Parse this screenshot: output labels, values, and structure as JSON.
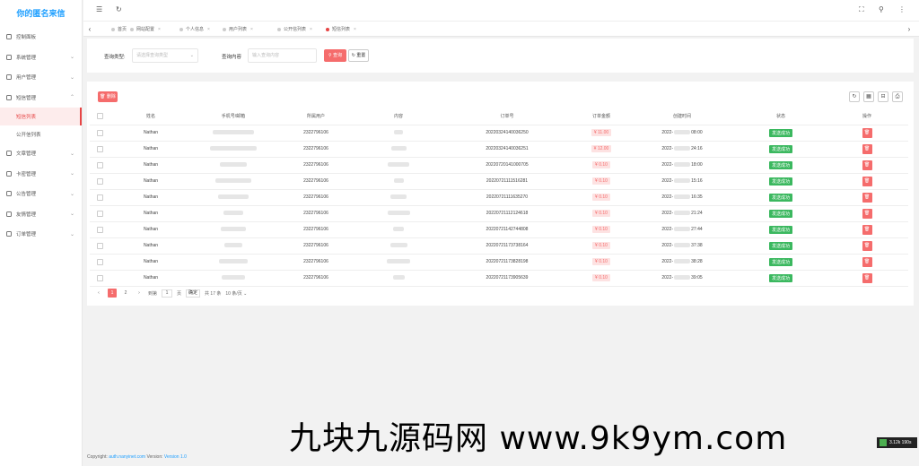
{
  "sidebar": {
    "logo": "你的匿名来信",
    "items": [
      {
        "label": "控制面板",
        "chev": ""
      },
      {
        "label": "系统管理",
        "chev": "⌄"
      },
      {
        "label": "用户管理",
        "chev": "⌄"
      },
      {
        "label": "短信管理",
        "chev": "⌃"
      }
    ],
    "sub_items": [
      {
        "label": "短信列表"
      },
      {
        "label": "公开信列表"
      }
    ],
    "items_after": [
      {
        "label": "文章管理",
        "chev": "⌄"
      },
      {
        "label": "卡密管理",
        "chev": "⌄"
      },
      {
        "label": "公告管理",
        "chev": "⌄"
      },
      {
        "label": "友情管理",
        "chev": "⌄"
      },
      {
        "label": "订单管理",
        "chev": "⌄"
      }
    ]
  },
  "header": {
    "menu_icon": "☰",
    "refresh_icon": "↻",
    "fullscreen_icon": "⛶",
    "user_icon": "⚲",
    "more_icon": "⋮"
  },
  "tabs": [
    {
      "label": "首页"
    },
    {
      "label": "网站配置"
    },
    {
      "label": "个人信息"
    },
    {
      "label": "用户列表"
    },
    {
      "label": "公开信列表"
    },
    {
      "label": "短信列表"
    }
  ],
  "search": {
    "type_label": "查询类型:",
    "type_placeholder": "请选择查询类型",
    "content_label": "查询内容",
    "content_placeholder": "输入查询内容",
    "search_btn": "查询",
    "reset_btn": "重置"
  },
  "table": {
    "delete_btn": "删除",
    "columns": [
      "",
      "姓名",
      "手机号/邮箱",
      "所属用户",
      "内容",
      "订单号",
      "订单金额",
      "创建时间",
      "状态",
      "操作"
    ],
    "rows": [
      {
        "name": "Nathan",
        "user": "2322796106",
        "order_no": "20220324140036250",
        "amount": "¥ 11.00",
        "time_pre": "2022-",
        "time_post": "08:00",
        "status": "发送成功"
      },
      {
        "name": "Nathan",
        "user": "2322796106",
        "order_no": "20220324140036251",
        "amount": "¥ 12.00",
        "time_pre": "2022-",
        "time_post": "24:16",
        "status": "发送成功"
      },
      {
        "name": "Nathan",
        "user": "2322796106",
        "order_no": "20220720141000705",
        "amount": "¥ 0.10",
        "time_pre": "2022-",
        "time_post": "18:00",
        "status": "发送成功"
      },
      {
        "name": "Nathan",
        "user": "2322796106",
        "order_no": "20220721111516281",
        "amount": "¥ 0.10",
        "time_pre": "2022-",
        "time_post": "15:16",
        "status": "发送成功"
      },
      {
        "name": "Nathan",
        "user": "2322796106",
        "order_no": "20220721111635270",
        "amount": "¥ 0.10",
        "time_pre": "2022-",
        "time_post": "16:35",
        "status": "发送成功"
      },
      {
        "name": "Nathan",
        "user": "2322796106",
        "order_no": "20220721112124618",
        "amount": "¥ 0.10",
        "time_pre": "2022-",
        "time_post": "21:24",
        "status": "发送成功"
      },
      {
        "name": "Nathan",
        "user": "2322796106",
        "order_no": "20220721142744808",
        "amount": "¥ 0.10",
        "time_pre": "2022-",
        "time_post": "27:44",
        "status": "发送成功"
      },
      {
        "name": "Nathan",
        "user": "2322796106",
        "order_no": "20220721173738164",
        "amount": "¥ 0.10",
        "time_pre": "2022-",
        "time_post": "37:38",
        "status": "发送成功"
      },
      {
        "name": "Nathan",
        "user": "2322796106",
        "order_no": "20220721173828198",
        "amount": "¥ 0.10",
        "time_pre": "2022-",
        "time_post": "38:28",
        "status": "发送成功"
      },
      {
        "name": "Nathan",
        "user": "2322796106",
        "order_no": "20220721173905639",
        "amount": "¥ 0.10",
        "time_pre": "2022-",
        "time_post": "39:05",
        "status": "发送成功"
      }
    ],
    "op_icon": "🗑"
  },
  "pager": {
    "prev": "‹",
    "page1": "1",
    "page2": "2",
    "next": "›",
    "goto_label": "到第",
    "goto_value": "1",
    "page_unit": "页",
    "confirm": "确定",
    "total": "共 17 条",
    "page_size": "10 条/页"
  },
  "footer": {
    "copyright": "Copyright:",
    "site": "auth.nanyinet.com",
    "version_label": "Version:",
    "version": "Version 1.0"
  },
  "watermark": "九块九源码网 www.9k9ym.com",
  "corner_badge": "3.12k   190s"
}
